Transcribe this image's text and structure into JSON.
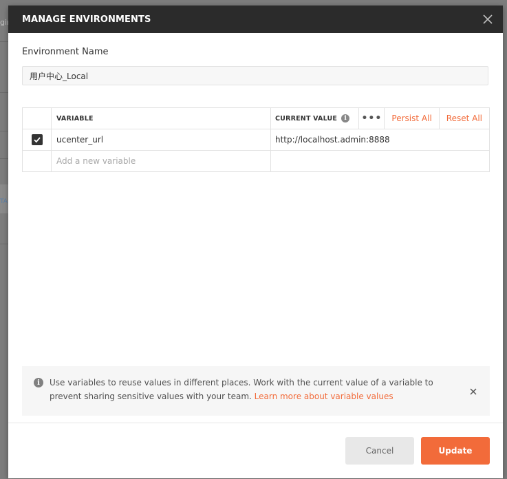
{
  "background": {
    "fragment_top": "gin",
    "fragment_mid": "TA"
  },
  "modal": {
    "title": "MANAGE ENVIRONMENTS",
    "env_name_label": "Environment Name",
    "env_name_value": "用户中心_Local"
  },
  "table": {
    "headers": {
      "variable": "VARIABLE",
      "current_value": "CURRENT VALUE",
      "more": "•••",
      "persist_all": "Persist All",
      "reset_all": "Reset All"
    },
    "rows": [
      {
        "checked": true,
        "variable": "ucenter_url",
        "current_value": "http://localhost.admin:8888"
      }
    ],
    "new_row_placeholder": "Add a new variable"
  },
  "banner": {
    "text": "Use variables to reuse values in different places. Work with the current value of a variable to prevent sharing sensitive values with your team. ",
    "link": "Learn more about variable values"
  },
  "footer": {
    "cancel_label": "Cancel",
    "update_label": "Update"
  },
  "colors": {
    "accent": "#f26b3a",
    "header_bg": "#2b2b2b",
    "overlay": "#7d7d7d"
  }
}
